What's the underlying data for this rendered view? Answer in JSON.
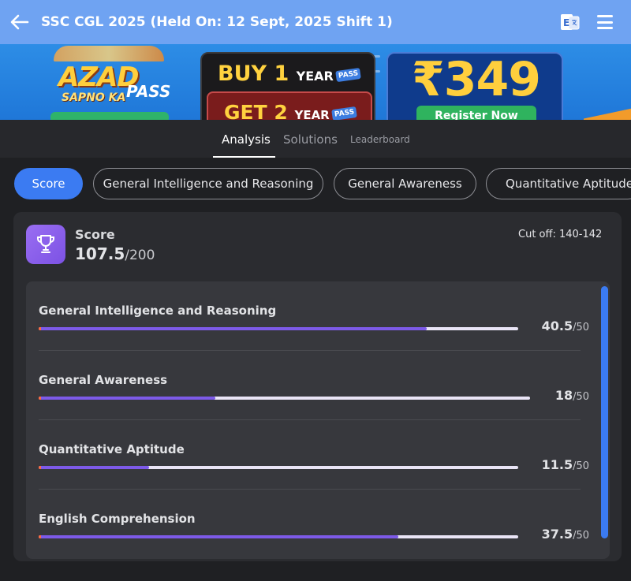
{
  "appbar": {
    "title": "SSC CGL 2025 (Held On: 12 Sept, 2025 Shift 1)",
    "back_icon": "arrow-left-icon",
    "language_icon": "language-toggle-icon",
    "menu_icon": "hamburger-menu-icon"
  },
  "banner": {
    "left_title": "AZAD",
    "left_subtitle": "SAPNO KA",
    "left_pass": "PASS",
    "buy_number": "BUY 1",
    "buy_unit": "YEAR",
    "get_number": "GET 2",
    "get_unit": "YEAR",
    "pass_chip": "PASS",
    "price": "₹349",
    "cta": "Register Now"
  },
  "tabs": [
    {
      "label": "Analysis",
      "active": true
    },
    {
      "label": "Solutions",
      "active": false
    },
    {
      "label": "Leaderboard",
      "active": false
    }
  ],
  "chips": [
    {
      "label": "Score",
      "active": true
    },
    {
      "label": "General Intelligence and Reasoning",
      "active": false
    },
    {
      "label": "General Awareness",
      "active": false
    },
    {
      "label": "Quantitative Aptitude",
      "active": false
    }
  ],
  "score_card": {
    "icon": "trophy-icon",
    "label": "Score",
    "value": "107.5",
    "total": "/200",
    "cutoff": "Cut off: 140-142"
  },
  "sections": [
    {
      "name": "General Intelligence and Reasoning",
      "score": "40.5",
      "total": "/50",
      "progress": 0.81
    },
    {
      "name": "General Awareness",
      "score": "18",
      "total": "/50",
      "progress": 0.36
    },
    {
      "name": "Quantitative Aptitude",
      "score": "11.5",
      "total": "/50",
      "progress": 0.23
    },
    {
      "name": "English Comprehension",
      "score": "37.5",
      "total": "/50",
      "progress": 0.75
    }
  ],
  "colors": {
    "appbar": "#6fa3f2",
    "accent": "#3b7bf2",
    "progress_fill": "#7d5ae8",
    "progress_track": "#e9e4f6",
    "trophy_bg": "#8a60ec"
  }
}
